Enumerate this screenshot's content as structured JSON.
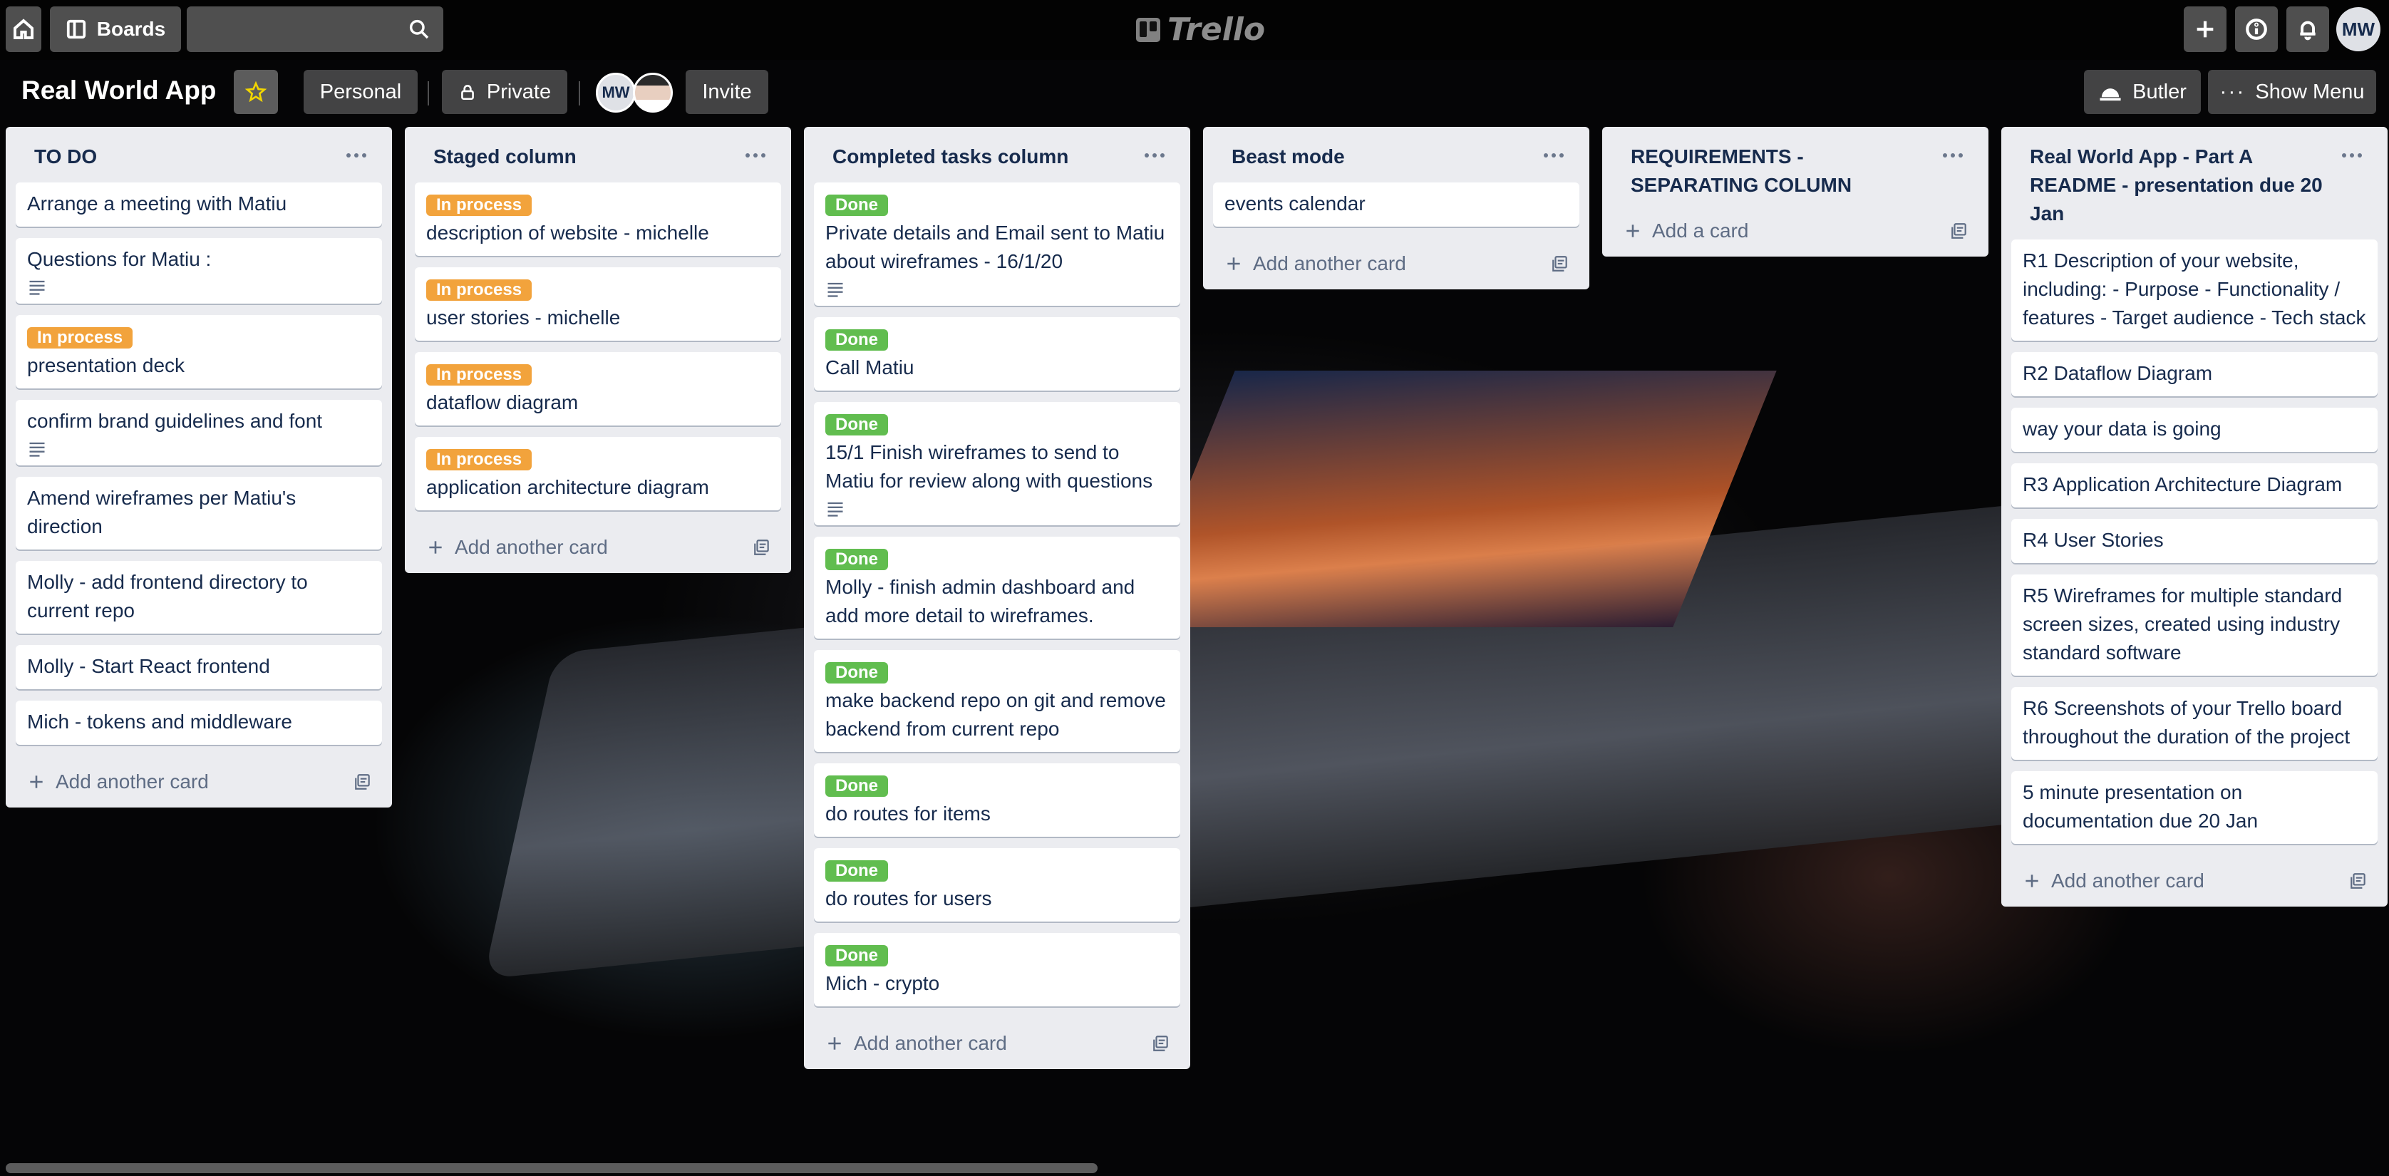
{
  "topbar": {
    "home_icon": "home-icon",
    "boards_label": "Boards",
    "search_placeholder": "",
    "logo_text": "Trello",
    "user_initials": "MW"
  },
  "board": {
    "title": "Real World App",
    "visibility_team": "Personal",
    "visibility": "Private",
    "member_initials": "MW",
    "invite_label": "Invite",
    "butler_label": "Butler",
    "show_menu_label": "Show Menu"
  },
  "lists": [
    {
      "title": "TO DO",
      "add_label": "Add another card",
      "cards": [
        {
          "text": "Arrange a meeting with Matiu",
          "label": "",
          "desc": false
        },
        {
          "text": "Questions for Matiu :",
          "label": "",
          "desc": true
        },
        {
          "text": "presentation deck",
          "label": "In process",
          "desc": false
        },
        {
          "text": "confirm brand guidelines and font",
          "label": "",
          "desc": true
        },
        {
          "text": "Amend wireframes per Matiu's direction",
          "label": "",
          "desc": false
        },
        {
          "text": "Molly - add frontend directory to current repo",
          "label": "",
          "desc": false
        },
        {
          "text": "Molly - Start React frontend",
          "label": "",
          "desc": false
        },
        {
          "text": "Mich - tokens and middleware",
          "label": "",
          "desc": false
        }
      ]
    },
    {
      "title": "Staged column",
      "add_label": "Add another card",
      "cards": [
        {
          "text": "description of website - michelle",
          "label": "In process",
          "desc": false
        },
        {
          "text": "user stories - michelle",
          "label": "In process",
          "desc": false
        },
        {
          "text": "dataflow diagram",
          "label": "In process",
          "desc": false
        },
        {
          "text": "application architecture diagram",
          "label": "In process",
          "desc": false
        }
      ]
    },
    {
      "title": "Completed tasks column",
      "add_label": "Add another card",
      "cards": [
        {
          "text": "Private details and Email sent to Matiu about wireframes - 16/1/20",
          "label": "Done",
          "desc": true
        },
        {
          "text": "Call Matiu",
          "label": "Done",
          "desc": false
        },
        {
          "text": "15/1 Finish wireframes to send to Matiu for review along with questions",
          "label": "Done",
          "desc": true
        },
        {
          "text": "Molly - finish admin dashboard and add more detail to wireframes.",
          "label": "Done",
          "desc": false
        },
        {
          "text": "make backend repo on git and remove backend from current repo",
          "label": "Done",
          "desc": false
        },
        {
          "text": "do routes for items",
          "label": "Done",
          "desc": false
        },
        {
          "text": "do routes for users",
          "label": "Done",
          "desc": false
        },
        {
          "text": "Mich - crypto",
          "label": "Done",
          "desc": false
        }
      ]
    },
    {
      "title": "Beast mode",
      "add_label": "Add another card",
      "cards": [
        {
          "text": "events calendar",
          "label": "",
          "desc": false
        }
      ]
    },
    {
      "title": "REQUIREMENTS - SEPARATING COLUMN",
      "add_label": "Add a card",
      "cards": []
    },
    {
      "title": "Real World App - Part A README - presentation due 20 Jan",
      "add_label": "Add another card",
      "cards": [
        {
          "text": "R1 Description of your website, including: - Purpose - Functionality / features - Target audience - Tech stack",
          "label": "",
          "desc": false
        },
        {
          "text": "R2 Dataflow Diagram",
          "label": "",
          "desc": false
        },
        {
          "text": "way your data is going",
          "label": "",
          "desc": false
        },
        {
          "text": "R3 Application Architecture Diagram",
          "label": "",
          "desc": false
        },
        {
          "text": "R4 User Stories",
          "label": "",
          "desc": false
        },
        {
          "text": "R5 Wireframes for multiple standard screen sizes, created using industry standard software",
          "label": "",
          "desc": false
        },
        {
          "text": "R6 Screenshots of your Trello board throughout the duration of the project",
          "label": "",
          "desc": false
        },
        {
          "text": "5 minute presentation on documentation due 20 Jan",
          "label": "",
          "desc": false
        }
      ]
    }
  ],
  "colors": {
    "in_process": "#f2a33c",
    "done": "#61bd4f",
    "list_bg": "#ebecf0"
  }
}
